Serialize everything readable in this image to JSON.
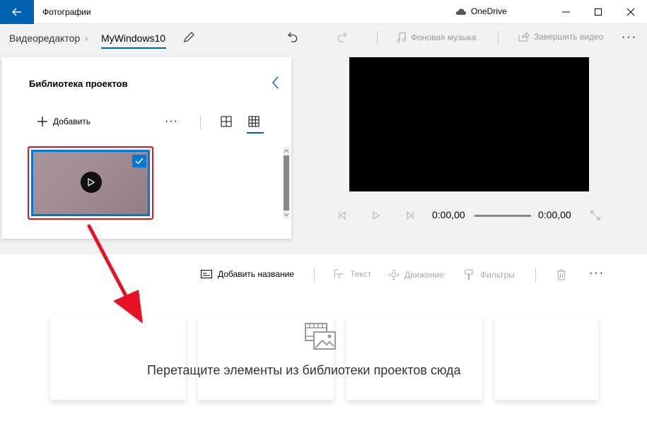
{
  "titlebar": {
    "app_title": "Фотографии",
    "onedrive_label": "OneDrive"
  },
  "breadcrumb": {
    "root": "Видеоредактор",
    "current": "MyWindows10"
  },
  "commands": {
    "background_music": "Фоновая музыка",
    "finish_video": "Завершить видео"
  },
  "library": {
    "title": "Библиотека проектов",
    "add_label": "Добавить",
    "more_label": "···"
  },
  "player": {
    "current_time": "0:00,00",
    "total_time": "0:00,00"
  },
  "storyboard": {
    "add_title": "Добавить название",
    "text": "Текст",
    "motion": "Движение",
    "filters": "Фильтры",
    "more": "···",
    "drop_hint": "Перетащите элементы из библиотеки проектов сюда"
  },
  "colors": {
    "accent": "#0063b1",
    "selection": "#0078d7",
    "highlight": "#e81123"
  }
}
